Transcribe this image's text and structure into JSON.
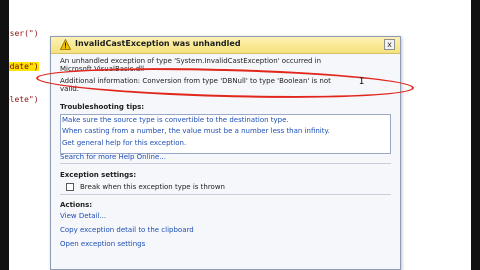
{
  "code": {
    "lines": [
      "inser(\")",
      "update\")",
      "delete\")",
      "\")"
    ]
  },
  "dialog": {
    "title": "InvalidCastException was unhandled",
    "close_glyph": "x",
    "message_line1": "An unhandled exception of type 'System.InvalidCastException' occurred in",
    "message_line2": "Microsoft.VisualBasic.dll",
    "additional_line1": "Additional information: Conversion from type 'DBNull' to type 'Boolean' is not",
    "additional_line2": "valid.",
    "cursor_glyph": "I"
  },
  "troubleshooting": {
    "header": "Troubleshooting tips:",
    "tips": [
      "Make sure the source type is convertible to the destination type.",
      "When casting from a number, the value must be a number less than infinity.",
      "Get general help for this exception."
    ],
    "search_link": "Search for more Help Online..."
  },
  "exception_settings": {
    "header": "Exception settings:",
    "checkbox_label": "Break when this exception type is thrown",
    "checked": false
  },
  "actions": {
    "header": "Actions:",
    "items": [
      "View Detail...",
      "Copy exception detail to the clipboard",
      "Open exception settings"
    ]
  },
  "colors": {
    "annotation": "#e1261c",
    "link": "#1f4fb4",
    "title_bar": "#f6e27a",
    "highlight": "#ffe400"
  }
}
